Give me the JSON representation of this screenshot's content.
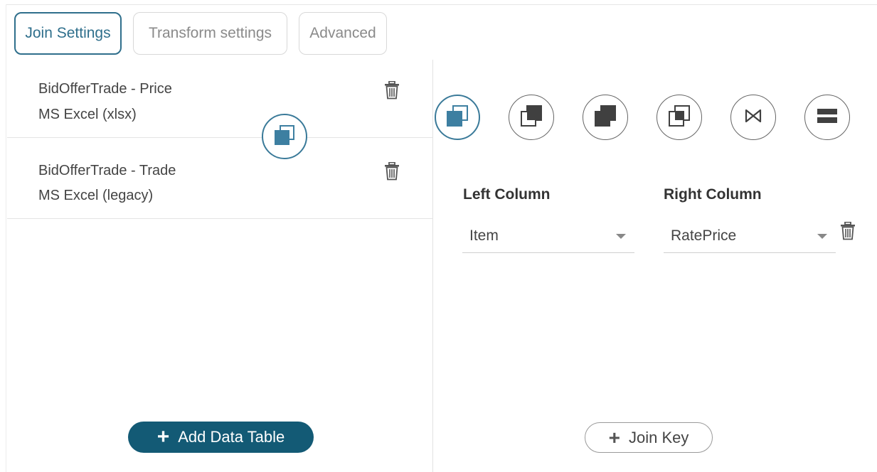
{
  "tabs": {
    "join": "Join Settings",
    "transform": "Transform settings",
    "advanced": "Advanced"
  },
  "tables": [
    {
      "name": "BidOfferTrade - Price",
      "type": "MS Excel (xlsx)"
    },
    {
      "name": "BidOfferTrade - Trade",
      "type": "MS Excel (legacy)"
    }
  ],
  "add_table_label": "Add Data Table",
  "join_types": [
    {
      "icon": "inner-join-icon",
      "active": true
    },
    {
      "icon": "left-outer-join-icon",
      "active": false
    },
    {
      "icon": "right-outer-join-icon",
      "active": false
    },
    {
      "icon": "full-outer-join-icon",
      "active": false
    },
    {
      "icon": "natural-join-icon",
      "active": false
    },
    {
      "icon": "union-icon",
      "active": false
    }
  ],
  "join_columns": {
    "left_label": "Left Column",
    "right_label": "Right Column",
    "left_value": "Item",
    "right_value": "RatePrice"
  },
  "join_key_label": "Join Key",
  "colors": {
    "accent": "#2f6f8c",
    "button_fill": "#135a75",
    "icon_dark": "#404040",
    "icon_blue": "#3d7fa1"
  }
}
